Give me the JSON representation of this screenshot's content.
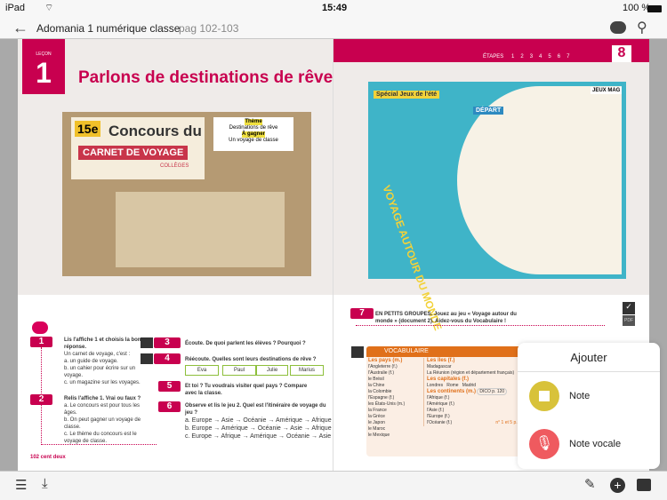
{
  "status": {
    "device": "iPad",
    "time": "15:49",
    "battery": "100 %"
  },
  "toolbar": {
    "title": "Adomania 1 numérique classe",
    "pages": "pag 102-103"
  },
  "left_page": {
    "lesson_label": "LEÇON",
    "lesson_number": "1",
    "title": "Parlons de destinations de rêve",
    "poster": {
      "edition": "15e",
      "line1": "Concours du",
      "line2": "CARNET DE VOYAGE",
      "line3": "COLLÈGES",
      "theme_label": "Thème",
      "theme": "Destinations de rêve",
      "prize_label": "À gagner",
      "prize": "Un voyage de classe"
    },
    "exercises": [
      {
        "n": "1",
        "title": "Lis l'affiche 1 et choisis la bonne réponse.",
        "intro": "Un carnet de voyage, c'est :",
        "items": [
          "a. un guide de voyage.",
          "b. un cahier pour écrire sur un voyage.",
          "c. un magazine sur les voyages."
        ]
      },
      {
        "n": "2",
        "title": "Relis l'affiche 1. Vrai ou faux ?",
        "items": [
          "a. Le concours est pour tous les âges.",
          "b. On peut gagner un voyage de classe.",
          "c. Le thème du concours est le voyage de classe."
        ]
      },
      {
        "n": "3",
        "title": "Écoute. De quoi parlent les élèves ? Pourquoi ?"
      },
      {
        "n": "4",
        "title": "Réécoute. Quelles sont leurs destinations de rêve ?",
        "names": [
          "Eva",
          "Paul",
          "Julie",
          "Marius"
        ]
      },
      {
        "n": "5",
        "title": "Et toi ? Tu voudrais visiter quel pays ? Compare avec la classe."
      },
      {
        "n": "6",
        "title": "Observe et lis le jeu 2. Quel est l'itinéraire de voyage du jeu ?",
        "items": [
          "a. Europe → Asie → Océanie → Amérique → Afrique",
          "b. Europe → Amérique → Océanie → Asie → Afrique",
          "c. Europe → Afrique → Amérique → Océanie → Asie"
        ]
      }
    ],
    "footer": "102 cent deux"
  },
  "right_page": {
    "etapes_label": "ÉTAPES",
    "etapes": [
      "1",
      "2",
      "3",
      "4",
      "5",
      "6",
      "7"
    ],
    "current_etape": "8",
    "game": {
      "badge": "Spécial Jeux de l'été",
      "mag": "JEUX MAG",
      "title": "VOYAGE AUTOUR DU MONDE",
      "start": "DÉPART"
    },
    "exercise7": {
      "n": "7",
      "text": "EN PETITS GROUPES. Jouez au jeu « Voyage autour du monde » (document 2). Aidez-vous du Vocabulaire !"
    },
    "vocab": {
      "header": "VOCABULAIRE",
      "pays_title": "Les pays (m.)",
      "pays": [
        "l'Angleterre (f.)",
        "l'Australie (f.)",
        "le Brésil",
        "la Chine",
        "la Colombie",
        "l'Espagne (f.)",
        "les États-Unis (m.)",
        "la France",
        "la Grèce",
        "le Japon",
        "le Maroc",
        "le Mexique"
      ],
      "iles_title": "Les îles (f.)",
      "iles": [
        "Madagascar",
        "La Réunion (région et département français)"
      ],
      "capitales_title": "Les capitales (f.)",
      "capitales": [
        "Londres",
        "Rome",
        "Madrid"
      ],
      "continents_title": "Les continents (m.)",
      "dico": "DICO p. 120",
      "continents": [
        "l'Afrique (f.)",
        "l'Amérique (f.)",
        "l'Asie (f.)",
        "l'Europe (f.)",
        "l'Océanie (f.)"
      ],
      "ref": "n° 1 et 5 p. 110"
    },
    "pdf": "PDF"
  },
  "popover": {
    "title": "Ajouter",
    "items": [
      {
        "label": "Note",
        "color": "#d8c23a"
      },
      {
        "label": "Note vocale",
        "color": "#ef5a5f"
      }
    ]
  },
  "colors": {
    "accent": "#c8004f",
    "orange": "#e0701a"
  }
}
